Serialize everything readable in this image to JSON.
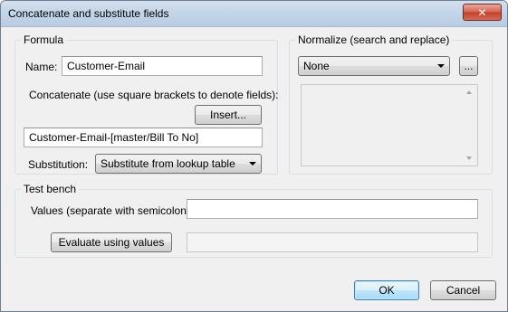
{
  "window": {
    "title": "Concatenate and substitute fields",
    "close_glyph": "✕"
  },
  "formula": {
    "legend": "Formula",
    "name_label": "Name:",
    "name_value": "Customer-Email",
    "concat_label": "Concatenate (use square brackets to denote fields):",
    "insert_button": "Insert...",
    "concat_value": "Customer-Email-[master/Bill To No]",
    "substitution_label": "Substitution:",
    "substitution_value": "Substitute from lookup table"
  },
  "normalize": {
    "legend": "Normalize (search and replace)",
    "select_value": "None",
    "browse_button": "..."
  },
  "testbench": {
    "legend": "Test bench",
    "values_label": "Values (separate with semicolon):",
    "values_value": "",
    "evaluate_button": "Evaluate using values",
    "result_value": ""
  },
  "footer": {
    "ok_button": "OK",
    "cancel_button": "Cancel"
  }
}
